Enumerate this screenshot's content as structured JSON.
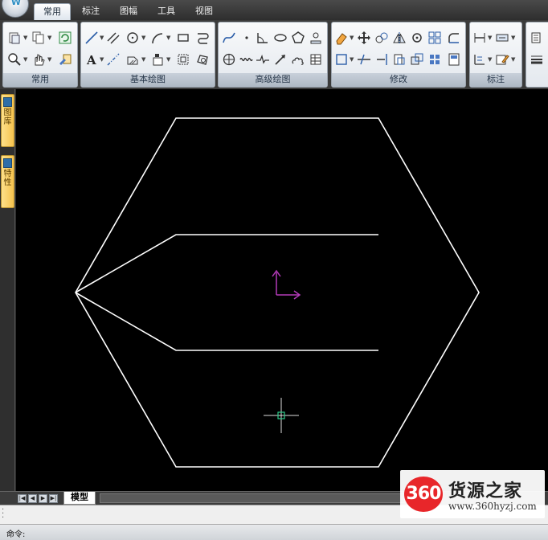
{
  "ribbon": {
    "tabs": [
      {
        "label": "常用",
        "active": true
      },
      {
        "label": "标注",
        "active": false
      },
      {
        "label": "图幅",
        "active": false
      },
      {
        "label": "工具",
        "active": false
      },
      {
        "label": "视图",
        "active": false
      }
    ],
    "panels": [
      {
        "label": "常用"
      },
      {
        "label": "基本绘图"
      },
      {
        "label": "高级绘图"
      },
      {
        "label": "修改"
      },
      {
        "label": "标注"
      }
    ]
  },
  "left_palette": {
    "tabs": [
      {
        "label": "图库"
      },
      {
        "label": "特性"
      }
    ]
  },
  "layout_bar": {
    "nav_buttons": [
      "|◀",
      "◀",
      "▶",
      "▶|"
    ],
    "model_tab": "模型"
  },
  "command_line": {
    "prompt": "命令:"
  },
  "watermark": {
    "badge": "360",
    "title": "货源之家",
    "url": "www.360hyzj.com"
  },
  "colors": {
    "canvas_background": "#000000",
    "drawing_lines": "#ffffff",
    "ucs_icon": "#b23ab8",
    "crosshair": "#ffffff",
    "pickbox": "#2ecc8a",
    "active_tab": "#ffffff",
    "watermark_badge": "#e8262a"
  }
}
